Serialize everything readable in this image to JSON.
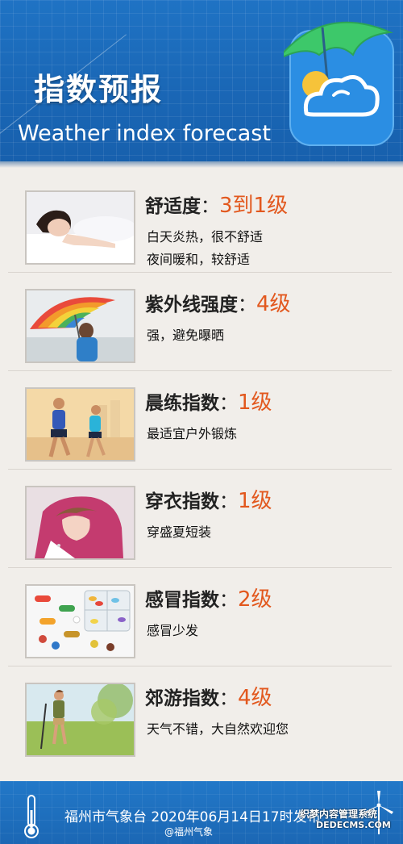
{
  "header": {
    "title": "指数预报",
    "subtitle": "Weather index forecast"
  },
  "items": [
    {
      "name": "舒适度",
      "colon": "：",
      "level": "3到1级",
      "lines": [
        "白天炎热，很不舒适",
        "夜间暖和，较舒适"
      ]
    },
    {
      "name": "紫外线强度",
      "colon": "：",
      "level": "4级",
      "lines": [
        "强，避免曝晒"
      ]
    },
    {
      "name": "晨练指数",
      "colon": "：",
      "level": "1级",
      "lines": [
        "最适宜户外锻炼"
      ]
    },
    {
      "name": "穿衣指数",
      "colon": "：",
      "level": "1级",
      "lines": [
        "穿盛夏短装"
      ]
    },
    {
      "name": "感冒指数",
      "colon": "：",
      "level": "2级",
      "lines": [
        "感冒少发"
      ]
    },
    {
      "name": "郊游指数",
      "colon": "：",
      "level": "4级",
      "lines": [
        "天气不错，大自然欢迎您"
      ]
    }
  ],
  "footer": {
    "publisher": "福州市气象台  2020年06月14日17时发布",
    "weibo": "@福州气象"
  },
  "watermark": {
    "line1": "织梦内容管理系统",
    "line2": "DEDECMS.COM"
  },
  "colors": {
    "header_blue": "#1f73c4",
    "level_orange": "#e2581e",
    "page_bg": "#f1eeea"
  },
  "icons": {
    "logo": "umbrella-sun-cloud-icon",
    "footer_left": "thermometer-icon",
    "footer_right": "wind-turbine-icon"
  }
}
